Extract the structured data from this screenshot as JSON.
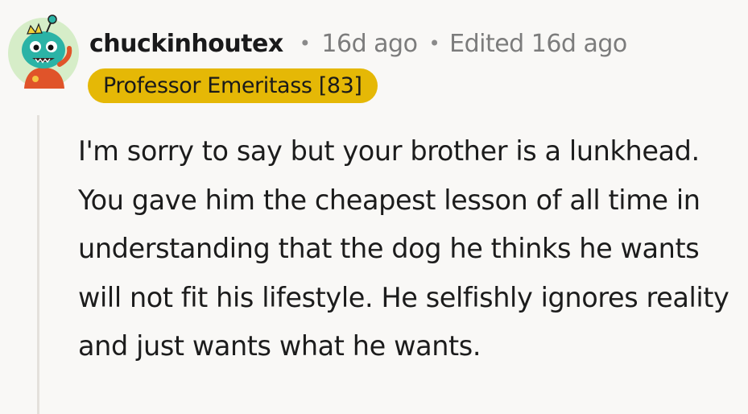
{
  "comment": {
    "username": "chuckinhoutex",
    "separator": "•",
    "posted": "16d ago",
    "edited": "Edited 16d ago",
    "flair": "Professor Emeritass [83]",
    "avatar_icon": "snoo-avatar-icon",
    "body": "I'm sorry to say but your brother is a lunkhead. You gave him the cheapest lesson of all time in understanding that the dog he thinks he wants will not fit his lifestyle. He selfishly ignores reality and just wants what he wants."
  },
  "colors": {
    "flair_bg": "#e5b806",
    "meta_text": "#7c7c7c",
    "avatar_bg": "#d6edc8",
    "avatar_face": "#2bb3a6"
  }
}
